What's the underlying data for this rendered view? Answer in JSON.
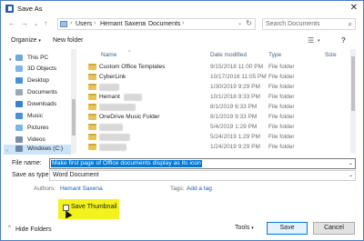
{
  "window": {
    "title": "Save As",
    "close_glyph": "✕"
  },
  "address": {
    "crumbs": [
      "Users",
      "Hemant Saxena",
      "Documents"
    ],
    "separator": "›",
    "search_placeholder": "Search Documents"
  },
  "toolbar": {
    "organize": "Organize",
    "new_folder": "New folder"
  },
  "nav": {
    "items": [
      {
        "label": "This PC",
        "icon": "pc-icon",
        "color": "#6fa8dc"
      },
      {
        "label": "3D Objects",
        "icon": "cube-icon",
        "color": "#7cb6e8"
      },
      {
        "label": "Desktop",
        "icon": "desktop-icon",
        "color": "#4a90d9"
      },
      {
        "label": "Documents",
        "icon": "documents-icon",
        "color": "#9aa7b6"
      },
      {
        "label": "Downloads",
        "icon": "download-icon",
        "color": "#3a7fd0"
      },
      {
        "label": "Music",
        "icon": "music-icon",
        "color": "#4a90d9"
      },
      {
        "label": "Pictures",
        "icon": "pictures-icon",
        "color": "#7cb6e8"
      },
      {
        "label": "Videos",
        "icon": "videos-icon",
        "color": "#7c8fa6"
      },
      {
        "label": "Windows (C:)",
        "icon": "drive-icon",
        "color": "#6d87a6"
      }
    ]
  },
  "columns": {
    "name": "Name",
    "date": "Date modified",
    "type": "Type",
    "size": "Size"
  },
  "files": [
    {
      "name": "Custom Office Templates",
      "date": "9/15/2018 11:00 PM",
      "type": "File folder",
      "blurred": false
    },
    {
      "name": "CyberLink",
      "date": "10/17/2018 11:05 PM",
      "type": "File folder",
      "blurred": false
    },
    {
      "name": "",
      "date": "1/30/2019 9:29 PM",
      "type": "File folder",
      "blurred": true,
      "blur_w": 22
    },
    {
      "name": "Hemant",
      "date": "10/1/2018 9:33 PM",
      "type": "File folder",
      "blurred": false,
      "blur_w": 20
    },
    {
      "name": "",
      "date": "8/1/2019 6:33 PM",
      "type": "File folder",
      "blurred": true,
      "blur_w": 40
    },
    {
      "name": "OneDrive Music Folder",
      "date": "8/1/2019 9:33 PM",
      "type": "File folder",
      "blurred": false
    },
    {
      "name": "",
      "date": "5/4/2019 1:29 PM",
      "type": "File folder",
      "blurred": true,
      "blur_w": 26
    },
    {
      "name": "",
      "date": "5/24/2019 1:29 PM",
      "type": "File folder",
      "blurred": true,
      "blur_w": 34
    },
    {
      "name": "",
      "date": "1/24/2019 9:29 PM",
      "type": "File folder",
      "blurred": true,
      "blur_w": 30
    }
  ],
  "form": {
    "file_name_label": "File name:",
    "file_name_value": "Make first page of Office documents display as its icon",
    "save_as_type_label": "Save as type:",
    "save_as_type_value": "Word Document",
    "authors_label": "Authors:",
    "authors_value": "Hemant Saxena",
    "tags_label": "Tags:",
    "tags_value": "Add a tag",
    "save_thumbnail_label": "Save Thumbnail",
    "save_thumbnail_checked": false
  },
  "footer": {
    "hide_folders": "Hide Folders",
    "tools": "Tools",
    "save": "Save",
    "cancel": "Cancel"
  },
  "colors": {
    "highlight": "#f2f21c",
    "selection": "#0078d7",
    "link": "#1a5fb4"
  }
}
